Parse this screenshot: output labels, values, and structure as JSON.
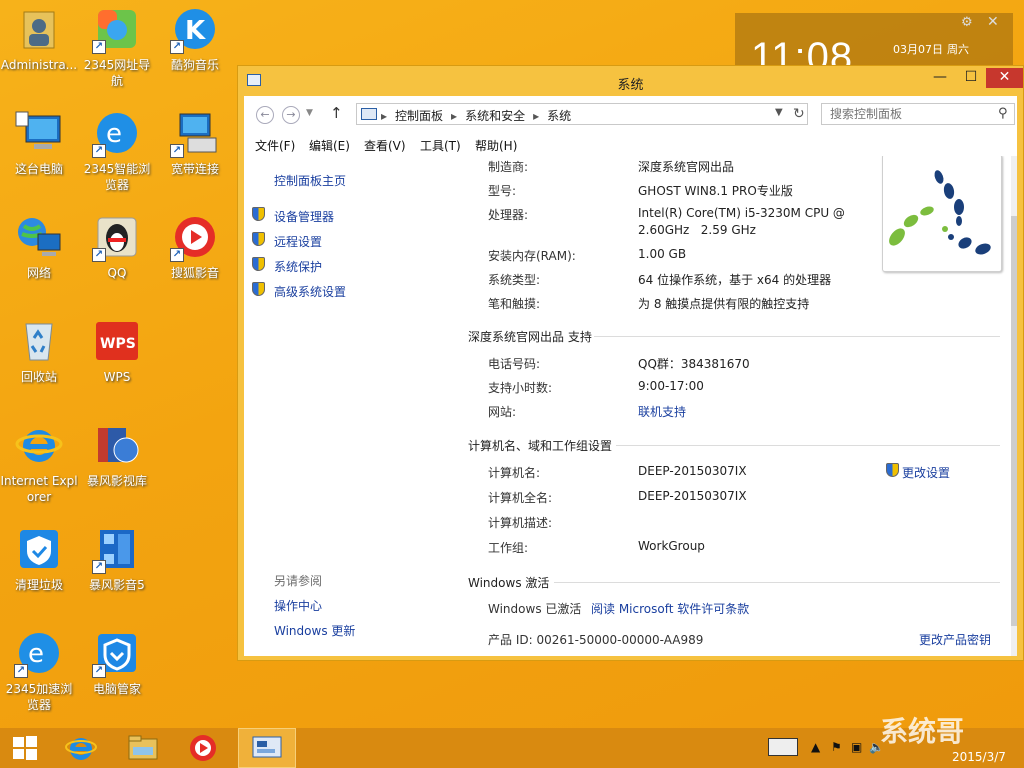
{
  "desktop": {
    "icons": [
      {
        "label": "Administra...",
        "icon": "user-folder-icon"
      },
      {
        "label": "2345网址导航",
        "icon": "2345-nav-icon"
      },
      {
        "label": "酷狗音乐",
        "icon": "kugou-music-icon"
      },
      {
        "label": "这台电脑",
        "icon": "computer-icon"
      },
      {
        "label": "2345智能浏览器",
        "icon": "2345-browser-icon"
      },
      {
        "label": "宽带连接",
        "icon": "broadband-icon"
      },
      {
        "label": "网络",
        "icon": "network-icon"
      },
      {
        "label": "QQ",
        "icon": "qq-icon"
      },
      {
        "label": "搜狐影音",
        "icon": "sohu-video-icon"
      },
      {
        "label": "回收站",
        "icon": "recycle-bin-icon"
      },
      {
        "label": "WPS",
        "icon": "wps-icon"
      },
      {
        "label": "Internet Explorer",
        "icon": "ie-icon"
      },
      {
        "label": "暴风影视库",
        "icon": "baofeng-library-icon"
      },
      {
        "label": "清理垃圾",
        "icon": "cleanup-icon"
      },
      {
        "label": "暴风影音5",
        "icon": "baofeng-player-icon"
      },
      {
        "label": "2345加速浏览器",
        "icon": "2345-accel-browser-icon"
      },
      {
        "label": "电脑管家",
        "icon": "pc-manager-icon"
      }
    ]
  },
  "clock_widget": {
    "time": "11:08",
    "date": "03月07日",
    "weekday": "周六"
  },
  "window": {
    "title": "系统",
    "breadcrumb": [
      "控制面板",
      "系统和安全",
      "系统"
    ],
    "search_placeholder": "搜索控制面板",
    "menu": [
      "文件(F)",
      "编辑(E)",
      "查看(V)",
      "工具(T)",
      "帮助(H)"
    ],
    "left_nav": {
      "home": "控制面板主页",
      "items": [
        "设备管理器",
        "远程设置",
        "系统保护",
        "高级系统设置"
      ],
      "see_also_header": "另请参阅",
      "see_also": [
        "操作中心",
        "Windows 更新"
      ]
    },
    "system": {
      "rows": [
        {
          "label": "制造商:",
          "value": "深度系统官网出品"
        },
        {
          "label": "型号:",
          "value": "GHOST WIN8.1 PRO专业版"
        },
        {
          "label": "处理器:",
          "value": "Intel(R) Core(TM) i5-3230M CPU @",
          "value2": "2.60GHz   2.59 GHz"
        },
        {
          "label": "安装内存(RAM):",
          "value": "1.00 GB"
        },
        {
          "label": "系统类型:",
          "value": "64 位操作系统，基于 x64 的处理器"
        },
        {
          "label": "笔和触摸:",
          "value": "为 8 触摸点提供有限的触控支持"
        }
      ]
    },
    "support": {
      "header": "深度系统官网出品 支持",
      "rows": [
        {
          "label": "电话号码:",
          "value": "QQ群：384381670"
        },
        {
          "label": "支持小时数:",
          "value": "9:00-17:00"
        },
        {
          "label": "网站:",
          "value": "联机支持"
        }
      ]
    },
    "computer": {
      "header": "计算机名、域和工作组设置",
      "change_settings": "更改设置",
      "rows": [
        {
          "label": "计算机名:",
          "value": "DEEP-20150307IX"
        },
        {
          "label": "计算机全名:",
          "value": "DEEP-20150307IX"
        },
        {
          "label": "计算机描述:",
          "value": ""
        },
        {
          "label": "工作组:",
          "value": "WorkGroup"
        }
      ]
    },
    "activation": {
      "header": "Windows 激活",
      "status": "Windows 已激活",
      "license_link": "阅读 Microsoft 软件许可条款",
      "product_id": "产品 ID: 00261-50000-00000-AA989",
      "change_key": "更改产品密钥"
    }
  },
  "taskbar": {
    "tray_date": "2015/3/7"
  },
  "watermark": "系统哥"
}
